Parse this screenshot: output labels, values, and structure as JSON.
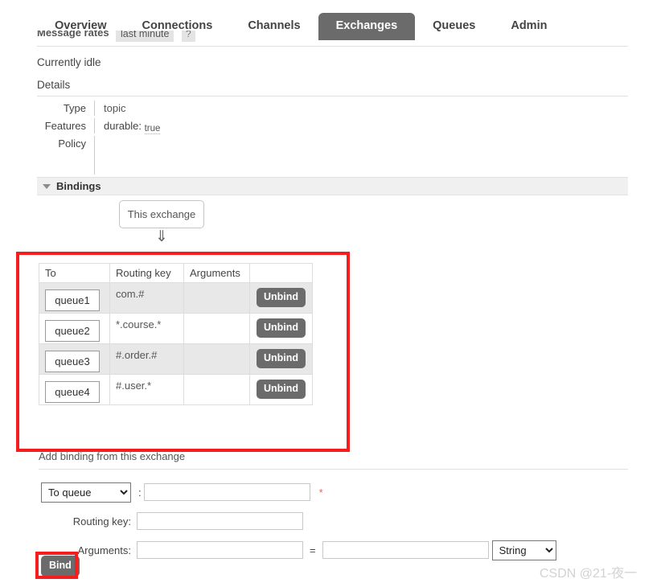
{
  "nav": {
    "tabs": [
      {
        "label": "Overview",
        "active": false
      },
      {
        "label": "Connections",
        "active": false
      },
      {
        "label": "Channels",
        "active": false
      },
      {
        "label": "Exchanges",
        "active": true
      },
      {
        "label": "Queues",
        "active": false
      },
      {
        "label": "Admin",
        "active": false
      }
    ]
  },
  "message_rates": {
    "label": "Message rates",
    "period": "last minute",
    "help": "?"
  },
  "status": {
    "currently_idle": "Currently idle",
    "details_heading": "Details"
  },
  "details": {
    "type_label": "Type",
    "type_value": "topic",
    "features_label": "Features",
    "features_key": "durable:",
    "features_value": "true",
    "policy_label": "Policy",
    "policy_value": ""
  },
  "bindings": {
    "section_title": "Bindings",
    "toggle_icon": "triangle-down-icon",
    "source_box_label": "This exchange",
    "arrow_glyph": "⇓",
    "columns": [
      "To",
      "Routing key",
      "Arguments",
      ""
    ],
    "rows": [
      {
        "to": "queue1",
        "routing_key": "com.#",
        "arguments": "",
        "action": "Unbind"
      },
      {
        "to": "queue2",
        "routing_key": "*.course.*",
        "arguments": "",
        "action": "Unbind"
      },
      {
        "to": "queue3",
        "routing_key": "#.order.#",
        "arguments": "",
        "action": "Unbind"
      },
      {
        "to": "queue4",
        "routing_key": "#.user.*",
        "arguments": "",
        "action": "Unbind"
      }
    ]
  },
  "add_binding": {
    "section_label": "Add binding from this exchange",
    "destination_select": "To queue",
    "destination_colon": ":",
    "destination_value": "",
    "required_marker": "*",
    "routing_key_label": "Routing key:",
    "routing_key_value": "",
    "arguments_label": "Arguments:",
    "arguments_key_value": "",
    "equals": "=",
    "arguments_val_value": "",
    "type_select": "String",
    "submit_label": "Bind"
  },
  "watermark": {
    "text": "CSDN @21-夜一"
  },
  "colors": {
    "accent_dark": "#6b6b6b",
    "annotation_red": "#f51e1e",
    "required_star": "#f06060",
    "row_stripe": "#e8e8e8"
  }
}
